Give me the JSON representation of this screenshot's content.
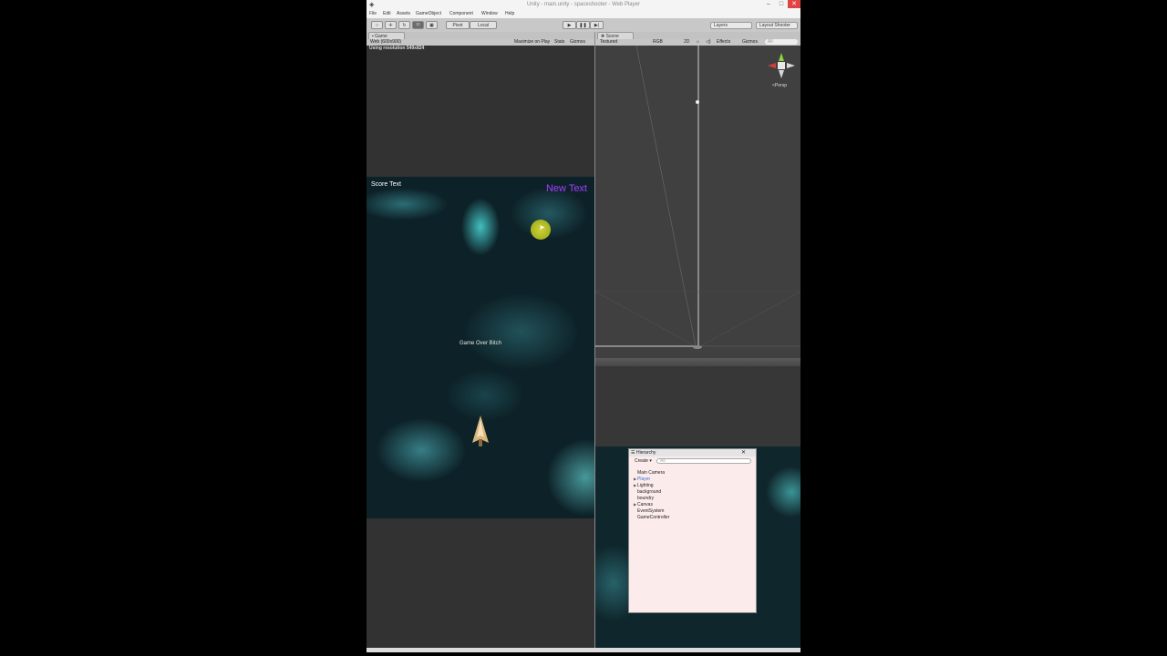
{
  "window": {
    "title": "Unity - main.unity - spaceshooter - Web Player",
    "minimize": "–",
    "maximize": "□",
    "close": "✕"
  },
  "menu": [
    "File",
    "Edit",
    "Assets",
    "GameObject",
    "Component",
    "Window",
    "Help"
  ],
  "toolbar": {
    "pivot_label": "Pivot",
    "local_label": "Local",
    "layers_label": "Layers",
    "layout_label": "Layout Shooter"
  },
  "game_view": {
    "tab_label": "Game",
    "resolution_dropdown": "Web (600x900)",
    "maximize_label": "Maximize on Play",
    "stats_label": "Stats",
    "gizmos_label": "Gizmos",
    "resolution_notice": "Using resolution 549x824",
    "score_text": "Score Text",
    "new_text": "New Text",
    "game_over_text": "Game Over Bitch"
  },
  "scene_view": {
    "tab_label": "Scene",
    "shading_label": "Textured",
    "rgb_label": "RGB",
    "mode_2d": "2D",
    "effects_label": "Effects",
    "gizmos_label": "Gizmos",
    "search_placeholder": "All",
    "persp_label": "Persp"
  },
  "hierarchy": {
    "title": "Hierarchy",
    "create_label": "Create",
    "search_placeholder": "All",
    "items": [
      {
        "label": "Main Camera",
        "selected": false,
        "expandable": false
      },
      {
        "label": "Player",
        "selected": true,
        "expandable": true
      },
      {
        "label": "Lighting",
        "selected": false,
        "expandable": true
      },
      {
        "label": "background",
        "selected": false,
        "expandable": false
      },
      {
        "label": "boundry",
        "selected": false,
        "expandable": false
      },
      {
        "label": "Canvas",
        "selected": false,
        "expandable": true
      },
      {
        "label": "EventSystem",
        "selected": false,
        "expandable": false
      },
      {
        "label": "GameController",
        "selected": false,
        "expandable": false
      }
    ]
  },
  "colors": {
    "new_text": "#a43cff",
    "selected_item": "#3a6fd8",
    "close_button": "#e04343"
  }
}
